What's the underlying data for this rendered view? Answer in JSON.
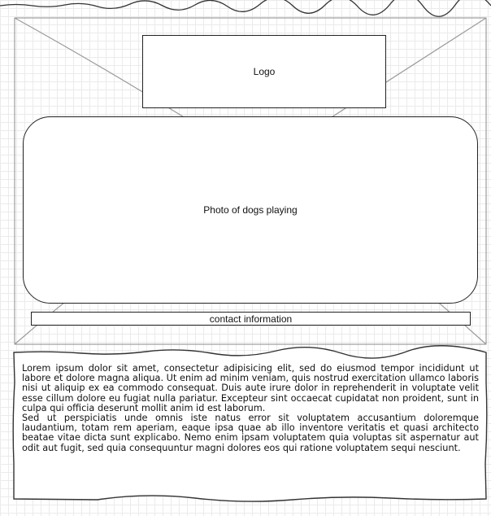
{
  "header": {
    "logo_label": "Logo",
    "photo_label": "Photo of dogs playing",
    "contact_label": "contact information"
  },
  "body_text": {
    "paragraph_1": "Lorem ipsum dolor sit amet, consectetur adipisicing elit, sed do eiusmod tempor incididunt ut labore et dolore magna aliqua. Ut enim ad minim veniam, quis nostrud exercitation ullamco laboris nisi ut aliquip ex ea commodo consequat. Duis aute irure dolor in reprehenderit in voluptate velit esse cillum dolore eu fugiat nulla pariatur. Excepteur sint occaecat cupidatat non proident, sunt in culpa qui officia deserunt mollit anim id est laborum.",
    "paragraph_2": "Sed ut perspiciatis unde omnis iste natus error sit voluptatem accusantium doloremque laudantium, totam rem aperiam, eaque ipsa quae ab illo inventore veritatis et quasi architecto beatae vitae dicta sunt explicabo. Nemo enim ipsam voluptatem quia voluptas sit aspernatur aut odit aut fugit, sed quia consequuntur magni dolores eos qui ratione voluptatem sequi nesciunt."
  }
}
